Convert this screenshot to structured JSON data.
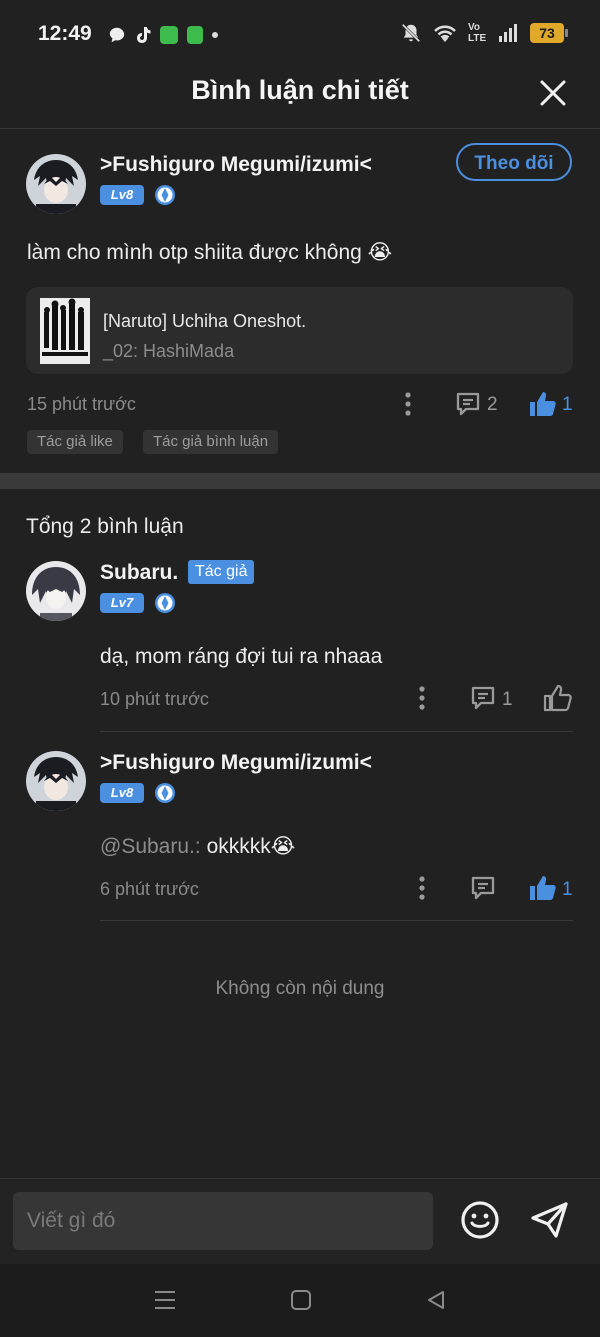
{
  "status_bar": {
    "time": "12:49",
    "network": "Vo LTE",
    "battery": "73"
  },
  "header": {
    "title": "Bình luận chi tiết"
  },
  "main_comment": {
    "username": ">Fushiguro Megumi/izumi<",
    "level": "Lv8",
    "follow_label": "Theo dõi",
    "text": "làm cho mình otp shiita được không 😭",
    "chapter": {
      "title": "[Naruto] Uchiha Oneshot.",
      "subtitle": "_02: HashiMada"
    },
    "time": "15 phút trước",
    "reply_count": "2",
    "like_count": "1",
    "tags": [
      "Tác giả like",
      "Tác giả bình luận"
    ]
  },
  "replies_section": {
    "total_label": "Tổng 2 bình luận",
    "replies": [
      {
        "username": "Subaru.",
        "author_badge": "Tác giả",
        "level": "Lv7",
        "text": "dạ, mom ráng đợi tui ra nhaaa",
        "time": "10 phút trước",
        "reply_count": "1"
      },
      {
        "username": ">Fushiguro Megumi/izumi<",
        "level": "Lv8",
        "mention": "@Subaru.:",
        "text": "okkkkk😭",
        "time": "6 phút trước",
        "like_count": "1"
      }
    ],
    "end_label": "Không còn nội dung"
  },
  "composer": {
    "placeholder": "Viết gì đó"
  },
  "colors": {
    "accent": "#4b8fe0",
    "background": "#212121"
  }
}
